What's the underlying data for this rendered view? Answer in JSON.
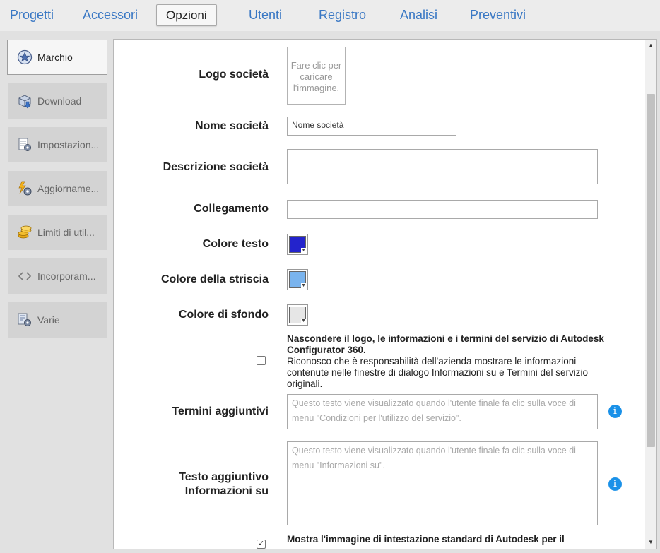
{
  "nav": {
    "tabs": [
      "Progetti",
      "Accessori",
      "Opzioni",
      "Utenti",
      "Registro",
      "Analisi",
      "Preventivi"
    ],
    "active": "Opzioni"
  },
  "sidebar": {
    "items": [
      {
        "label": "Marchio",
        "icon": "star-badge-icon"
      },
      {
        "label": "Download",
        "icon": "download-box-icon"
      },
      {
        "label": "Impostazion...",
        "icon": "settings-page-icon"
      },
      {
        "label": "Aggiorname...",
        "icon": "update-gear-icon"
      },
      {
        "label": "Limiti di util...",
        "icon": "coins-icon"
      },
      {
        "label": "Incorporam...",
        "icon": "embed-code-icon"
      },
      {
        "label": "Varie",
        "icon": "misc-settings-icon"
      }
    ]
  },
  "form": {
    "logo_label": "Logo società",
    "logo_upload_text": "Fare clic per caricare l'immagine.",
    "name_label": "Nome società",
    "name_value": "Nome società",
    "description_label": "Descrizione società",
    "description_value": "",
    "link_label": "Collegamento",
    "link_value": "",
    "text_color_label": "Colore testo",
    "strip_color_label": "Colore della striscia",
    "bg_color_label": "Colore di sfondo",
    "hide_logo_title": "Nascondere il logo, le informazioni e i termini del servizio di Autodesk Configurator 360.",
    "hide_logo_body": "Riconosco che è responsabilità dell'azienda mostrare le informazioni contenute nelle finestre di dialogo Informazioni su e Termini del servizio originali.",
    "hide_logo_checked": false,
    "terms_label": "Termini aggiuntivi",
    "terms_placeholder": "Questo testo viene visualizzato quando l'utente finale fa clic sulla voce di menu \"Condizioni per l'utilizzo del servizio\".",
    "about_label_line1": "Testo aggiuntivo",
    "about_label_line2": "Informazioni su",
    "about_placeholder": "Questo testo viene visualizzato quando l'utente finale fa clic sulla voce di menu \"Informazioni su\".",
    "header_image_text": "Mostra l'immagine di intestazione standard di Autodesk per il",
    "header_image_checked": true,
    "info_icon_glyph": "i"
  },
  "colors": {
    "text_color": "#2323cc",
    "strip_color": "#7ab4ee",
    "bg_color": "#e6e6e6",
    "link": "#3a78c4",
    "info": "#1a91e8"
  }
}
